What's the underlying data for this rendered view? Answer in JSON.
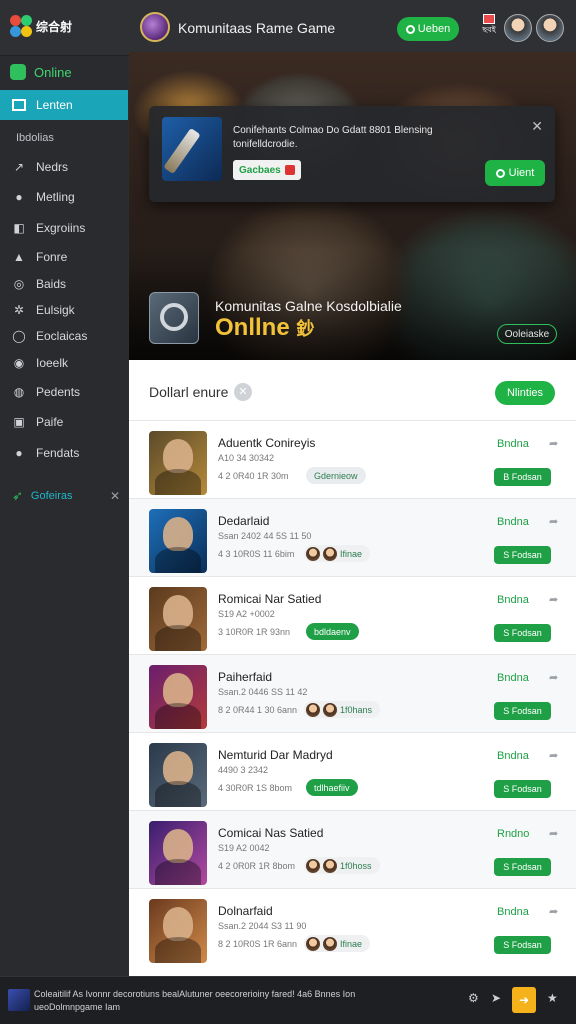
{
  "topbar": {
    "logo_text": "综合射",
    "app_title": "Komunitaas Rame Game",
    "primary_button": "Ueben",
    "notification_label": "ছবই"
  },
  "sidebar": {
    "online_label": "Online",
    "active_label": "Lenten",
    "section_label": "Ibdolias",
    "items": [
      {
        "label": "Nedrs",
        "icon": "arrow-icon"
      },
      {
        "label": "Metling",
        "icon": "pin-icon"
      },
      {
        "label": "Exgroiins",
        "icon": "puzzle-icon"
      },
      {
        "label": "Fonre",
        "icon": "triangle-icon"
      },
      {
        "label": "Baids",
        "icon": "circle-icon"
      },
      {
        "label": "Eulsigk",
        "icon": "gear-icon"
      },
      {
        "label": "Eoclaicas",
        "icon": "ring-icon"
      },
      {
        "label": "Ioeelk",
        "icon": "dot-icon"
      },
      {
        "label": "Pedents",
        "icon": "badge-icon"
      },
      {
        "label": "Paife",
        "icon": "image-icon"
      },
      {
        "label": "Fendats",
        "icon": "dot-icon"
      }
    ],
    "footer_label": "Gofeiras"
  },
  "hero": {
    "toast_text": "Conifehants Colmao Do Gdatt 8801 Blensing tonifelldcrodie.",
    "toast_chip": "Gacbaes",
    "toast_button": "Uient",
    "title": "Komunitas Galne Kosdolbialie",
    "subtitle": "Onllne",
    "subtitle_glyph": "鈔",
    "button": "Ooleiaske"
  },
  "filter": {
    "label": "Dollarl enure",
    "button": "Nlinties"
  },
  "rows": [
    {
      "title": "Aduentk Conireyis",
      "meta1": "A10 34 30342",
      "meta2": "4 2 0R40 1R 30m",
      "tag": "Gdernieow",
      "tag_style": "grey",
      "status": "Bndna",
      "button": "B Fodsan",
      "colors": [
        "#5b4a2a",
        "#b58a3a"
      ]
    },
    {
      "title": "Dedarlaid",
      "meta1": "Ssan 2402 44 5S 11 50",
      "meta2": "4 3 10R0S 11 6bim",
      "tag": "Ifinae",
      "tag_style": "avatars",
      "status": "Bndna",
      "button": "S Fodsan",
      "colors": [
        "#1e6fb8",
        "#0b2f5a"
      ]
    },
    {
      "title": "Romicai Nar Satied",
      "meta1": "S19 A2 +0002",
      "meta2": "3 10R0R 1R 93nn",
      "tag": "bdldaenv",
      "tag_style": "green",
      "status": "Bndna",
      "button": "S Fodsan",
      "colors": [
        "#5a3a1e",
        "#a06a3a"
      ]
    },
    {
      "title": "Paiherfaid",
      "meta1": "Ssan.2 0446 SS 11 42",
      "meta2": "8 2 0R44 1 30 6ann",
      "tag": "1f0hans",
      "tag_style": "avatars",
      "status": "Bndna",
      "button": "S Fodsan",
      "colors": [
        "#6a1e6e",
        "#b23a3a"
      ]
    },
    {
      "title": "Nemturid Dar Madryd",
      "meta1": "4490 3 2342",
      "meta2": "4 30R0R 1S 8bom",
      "tag": "tdlhaefiiv",
      "tag_style": "green",
      "status": "Bndna",
      "button": "S Fodsan",
      "colors": [
        "#2a3a4a",
        "#5a6a7a"
      ]
    },
    {
      "title": "Comicai Nas Satied",
      "meta1": "S19 A2 0042",
      "meta2": "4 2 0R0R 1R 8bom",
      "tag": "1f0hoss",
      "tag_style": "avatars",
      "status": "Rndno",
      "button": "S Fodsan",
      "colors": [
        "#3a1e6e",
        "#b24aa0"
      ]
    },
    {
      "title": "Dolnarfaid",
      "meta1": "Ssan.2 2044 S3 11 90",
      "meta2": "8 2 10R0S 1R 6ann",
      "tag": "Ifinae",
      "tag_style": "avatars",
      "status": "Bndna",
      "button": "S Fodsan",
      "colors": [
        "#6a3a1e",
        "#d08a4a"
      ]
    }
  ],
  "bottombar": {
    "text": "Coleaitilif As Ivonnr decorotiuns bealAlutuner oeecorerioiny fared! 4a6 Bnnes Ion ueoDolmnpgame Iam"
  },
  "colors": {
    "accent_green": "#1fb345",
    "sidebar_active": "#1aa5b8",
    "hero_gold": "#f2c23a"
  }
}
